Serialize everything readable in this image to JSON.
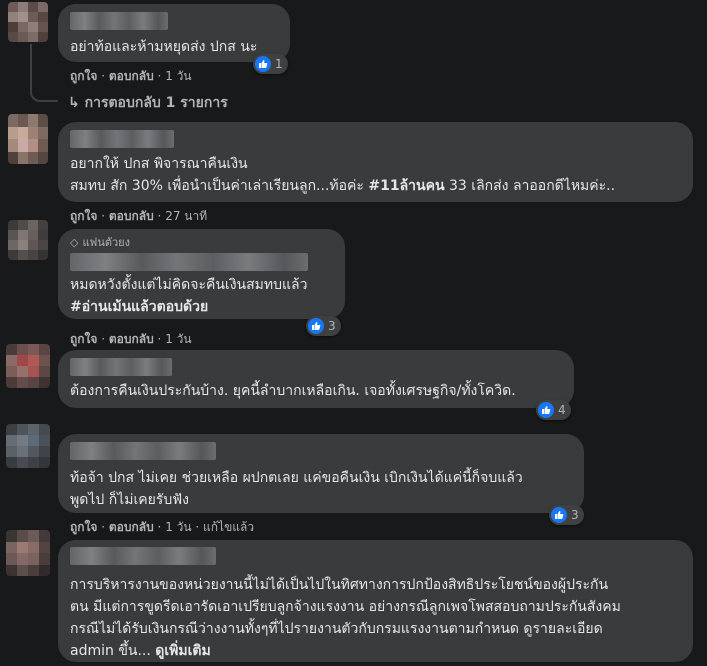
{
  "actions": {
    "like": "ถูกใจ",
    "reply": "ตอบกลับ",
    "edited": "แก้ไขแล้ว"
  },
  "colors": {
    "background": "#18191a",
    "bubble": "#3a3b3c",
    "like_blue": "#1877f2",
    "secondary_text": "#b0b3b8"
  },
  "comments": [
    {
      "line1": "อย่าท้อและห้ามหยุดส่ง ปกส นะ",
      "time": "1 วัน",
      "reactions": "1",
      "reply_summary": "การตอบกลับ 1 รายการ"
    },
    {
      "line1": "อยากให้ ปกส พิจารณาคืนเงิน",
      "line2_pre": "สมทบ สัก 30% เพื่อนำเป็นค่าเล่าเรียนลูก...ท้อค่ะ ",
      "line2_tag": "#11ล้านคน",
      "line2_post": " 33 เลิกส่ง ลาออกดีไหมค่ะ..",
      "time": "27 นาที"
    },
    {
      "badge": "แฟนตัวยง",
      "line1": "หมดหวังตั้งแต่ไม่คิดจะคืนเงินสมทบแล้ว",
      "line2": "#อ่านเม้นแล้วตอบด้วย",
      "time": "1 วัน",
      "reactions": "3"
    },
    {
      "line1": "ต้องการคืนเงินประกันบ้าง. ยุคนี้ลำบากเหลือเกิน. เจอทั้งเศรษฐกิจ/ทั้งโควิด.",
      "reactions": "4"
    },
    {
      "line1": "ท้อจ้า ปกส ไม่เคย ช่วยเหลือ ผปกตเลย แค่ขอคืนเงิน เบิกเงินได้แค่นี้ก็จบแล้ว",
      "line2": "พูดไป ก็ไม่เคยรับฟัง",
      "time": "1 วัน",
      "reactions": "3"
    },
    {
      "line1": "การบริหารงานของหน่วยงานนี้ไม่ได้เป็นไปในทิศทางการปกป้องสิทธิประโยชน์ของผู้ประกัน",
      "line2": "ตน มีแต่การขูดรีดเอารัดเอาเปรียบลูกจ้างแรงงาน อย่างกรณีลูกเพจโพสสอบถามประกันสังคม",
      "line3": "กรณีไม่ได้รับเงินกรณีว่างงานทั้งๆที่ไปรายงานตัวกับกรมแรงงานตามกำหนด ดูรายละเอียด",
      "line4_pre": "admin ขึ้น... ",
      "line4_more": "ดูเพิ่มเติม"
    }
  ]
}
